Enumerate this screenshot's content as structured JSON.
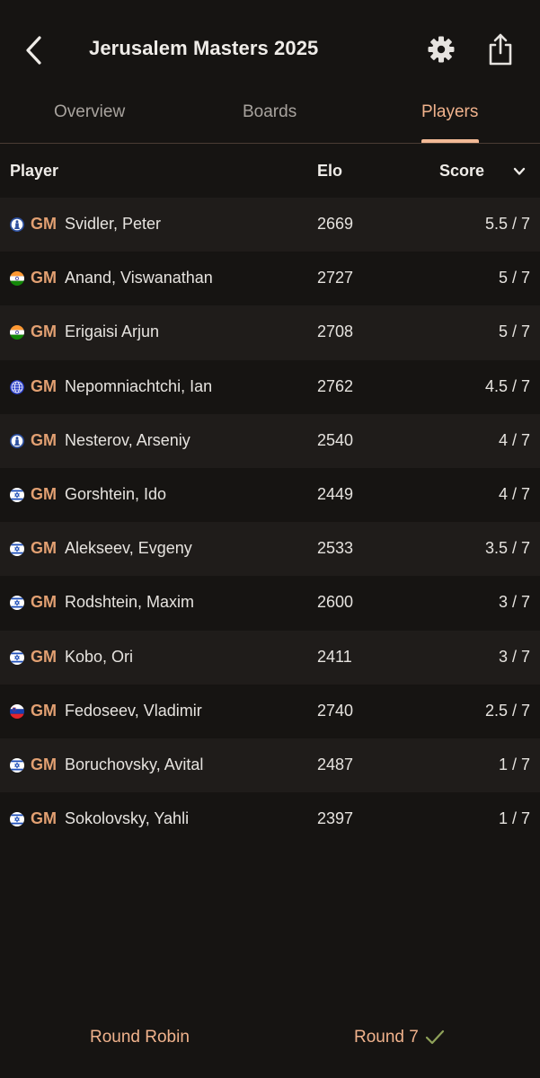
{
  "header": {
    "title": "Jerusalem Masters 2025",
    "back_icon": "chevron-left-icon",
    "settings_icon": "gear-icon",
    "share_icon": "share-icon"
  },
  "tabs": [
    {
      "label": "Overview",
      "active": false
    },
    {
      "label": "Boards",
      "active": false
    },
    {
      "label": "Players",
      "active": true
    }
  ],
  "table": {
    "columns": {
      "player": "Player",
      "elo": "Elo",
      "score": "Score"
    },
    "sort_icon": "chevron-down-icon",
    "rows": [
      {
        "flag": "fide",
        "title": "GM",
        "name": "Svidler, Peter",
        "elo": "2669",
        "score": "5.5 / 7"
      },
      {
        "flag": "india",
        "title": "GM",
        "name": "Anand, Viswanathan",
        "elo": "2727",
        "score": "5 / 7"
      },
      {
        "flag": "india",
        "title": "GM",
        "name": "Erigaisi Arjun",
        "elo": "2708",
        "score": "5 / 7"
      },
      {
        "flag": "globe",
        "title": "GM",
        "name": "Nepomniachtchi, Ian",
        "elo": "2762",
        "score": "4.5 / 7"
      },
      {
        "flag": "fide",
        "title": "GM",
        "name": "Nesterov, Arseniy",
        "elo": "2540",
        "score": "4 / 7"
      },
      {
        "flag": "israel",
        "title": "GM",
        "name": "Gorshtein, Ido",
        "elo": "2449",
        "score": "4 / 7"
      },
      {
        "flag": "israel",
        "title": "GM",
        "name": "Alekseev, Evgeny",
        "elo": "2533",
        "score": "3.5 / 7"
      },
      {
        "flag": "israel",
        "title": "GM",
        "name": "Rodshtein, Maxim",
        "elo": "2600",
        "score": "3 / 7"
      },
      {
        "flag": "israel",
        "title": "GM",
        "name": "Kobo, Ori",
        "elo": "2411",
        "score": "3 / 7"
      },
      {
        "flag": "slovenia",
        "title": "GM",
        "name": "Fedoseev, Vladimir",
        "elo": "2740",
        "score": "2.5 / 7"
      },
      {
        "flag": "israel",
        "title": "GM",
        "name": "Boruchovsky, Avital",
        "elo": "2487",
        "score": "1 / 7"
      },
      {
        "flag": "israel",
        "title": "GM",
        "name": "Sokolovsky, Yahli",
        "elo": "2397",
        "score": "1 / 7"
      }
    ]
  },
  "footer": {
    "format": "Round Robin",
    "round": "Round 7",
    "round_status_icon": "checkmark-icon"
  },
  "colors": {
    "background": "#161412",
    "row_alt": "#1f1c1a",
    "accent": "#f0b28c",
    "title_badge": "#e2a072",
    "check": "#8fa25a"
  }
}
